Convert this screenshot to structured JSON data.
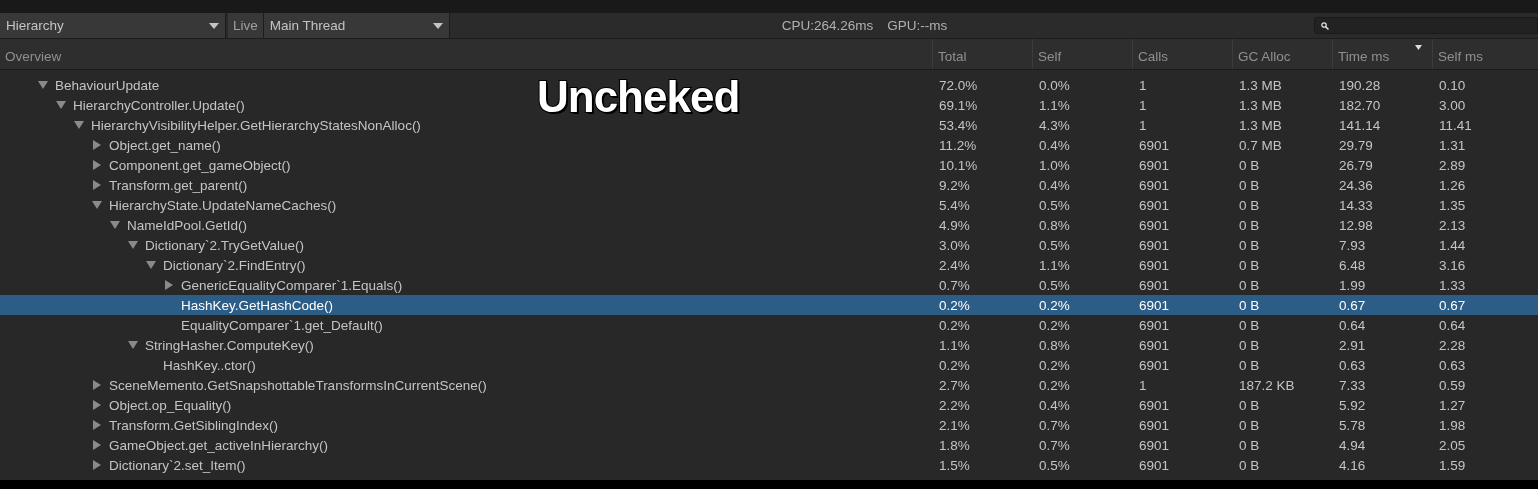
{
  "toolbar": {
    "view_dropdown": "Hierarchy",
    "live_button": "Live",
    "thread_dropdown": "Main Thread",
    "cpu": "CPU:264.26ms",
    "gpu": "GPU:--ms"
  },
  "table": {
    "columns": [
      {
        "label": "Overview",
        "sorted": false
      },
      {
        "label": "Total",
        "sorted": false
      },
      {
        "label": "Self",
        "sorted": false
      },
      {
        "label": "Calls",
        "sorted": false
      },
      {
        "label": "GC Alloc",
        "sorted": false
      },
      {
        "label": "Time ms",
        "sorted": true
      },
      {
        "label": "Self ms",
        "sorted": false
      }
    ],
    "rows": [
      {
        "kind": "group",
        "expanded": true,
        "selected": false,
        "cells": [
          "BehaviourUpdate",
          "72.0%",
          "0.0%",
          "1",
          "1.3 MB",
          "190.28",
          "0.10"
        ],
        "children": [
          {
            "kind": "group",
            "expanded": true,
            "selected": false,
            "cells": [
              "HierarchyController.Update()",
              "69.1%",
              "1.1%",
              "1",
              "1.3 MB",
              "182.70",
              "3.00"
            ],
            "children": [
              {
                "kind": "group",
                "expanded": true,
                "selected": false,
                "cells": [
                  "HierarchyVisibilityHelper.GetHierarchyStatesNonAlloc()",
                  "53.4%",
                  "4.3%",
                  "1",
                  "1.3 MB",
                  "141.14",
                  "11.41"
                ],
                "children": [
                  {
                    "kind": "group",
                    "expanded": false,
                    "selected": false,
                    "cells": [
                      "Object.get_name()",
                      "11.2%",
                      "0.4%",
                      "6901",
                      "0.7 MB",
                      "29.79",
                      "1.31"
                    ]
                  },
                  {
                    "kind": "group",
                    "expanded": false,
                    "selected": false,
                    "cells": [
                      "Component.get_gameObject()",
                      "10.1%",
                      "1.0%",
                      "6901",
                      "0 B",
                      "26.79",
                      "2.89"
                    ]
                  },
                  {
                    "kind": "group",
                    "expanded": false,
                    "selected": false,
                    "cells": [
                      "Transform.get_parent()",
                      "9.2%",
                      "0.4%",
                      "6901",
                      "0 B",
                      "24.36",
                      "1.26"
                    ]
                  },
                  {
                    "kind": "group",
                    "expanded": true,
                    "selected": false,
                    "cells": [
                      "HierarchyState.UpdateNameCaches()",
                      "5.4%",
                      "0.5%",
                      "6901",
                      "0 B",
                      "14.33",
                      "1.35"
                    ],
                    "children": [
                      {
                        "kind": "group",
                        "expanded": true,
                        "selected": false,
                        "cells": [
                          "NameIdPool.GetId()",
                          "4.9%",
                          "0.8%",
                          "6901",
                          "0 B",
                          "12.98",
                          "2.13"
                        ],
                        "children": [
                          {
                            "kind": "group",
                            "expanded": true,
                            "selected": false,
                            "cells": [
                              "Dictionary`2.TryGetValue()",
                              "3.0%",
                              "0.5%",
                              "6901",
                              "0 B",
                              "7.93",
                              "1.44"
                            ],
                            "children": [
                              {
                                "kind": "group",
                                "expanded": true,
                                "selected": false,
                                "cells": [
                                  "Dictionary`2.FindEntry()",
                                  "2.4%",
                                  "1.1%",
                                  "6901",
                                  "0 B",
                                  "6.48",
                                  "3.16"
                                ],
                                "children": [
                                  {
                                    "kind": "group",
                                    "expanded": false,
                                    "selected": false,
                                    "cells": [
                                      "GenericEqualityComparer`1.Equals()",
                                      "0.7%",
                                      "0.5%",
                                      "6901",
                                      "0 B",
                                      "1.99",
                                      "1.33"
                                    ]
                                  },
                                  {
                                    "kind": "leaf",
                                    "selected": true,
                                    "cells": [
                                      "HashKey.GetHashCode()",
                                      "0.2%",
                                      "0.2%",
                                      "6901",
                                      "0 B",
                                      "0.67",
                                      "0.67"
                                    ]
                                  },
                                  {
                                    "kind": "leaf",
                                    "selected": false,
                                    "cells": [
                                      "EqualityComparer`1.get_Default()",
                                      "0.2%",
                                      "0.2%",
                                      "6901",
                                      "0 B",
                                      "0.64",
                                      "0.64"
                                    ]
                                  }
                                ]
                              }
                            ]
                          },
                          {
                            "kind": "group",
                            "expanded": true,
                            "selected": false,
                            "cells": [
                              "StringHasher.ComputeKey()",
                              "1.1%",
                              "0.8%",
                              "6901",
                              "0 B",
                              "2.91",
                              "2.28"
                            ],
                            "children": [
                              {
                                "kind": "leaf",
                                "selected": false,
                                "cells": [
                                  "HashKey..ctor()",
                                  "0.2%",
                                  "0.2%",
                                  "6901",
                                  "0 B",
                                  "0.63",
                                  "0.63"
                                ]
                              }
                            ]
                          }
                        ]
                      }
                    ]
                  },
                  {
                    "kind": "group",
                    "expanded": false,
                    "selected": false,
                    "cells": [
                      "SceneMemento.GetSnapshottableTransformsInCurrentScene()",
                      "2.7%",
                      "0.2%",
                      "1",
                      "187.2 KB",
                      "7.33",
                      "0.59"
                    ]
                  },
                  {
                    "kind": "group",
                    "expanded": false,
                    "selected": false,
                    "cells": [
                      "Object.op_Equality()",
                      "2.2%",
                      "0.4%",
                      "6901",
                      "0 B",
                      "5.92",
                      "1.27"
                    ]
                  },
                  {
                    "kind": "group",
                    "expanded": false,
                    "selected": false,
                    "cells": [
                      "Transform.GetSiblingIndex()",
                      "2.1%",
                      "0.7%",
                      "6901",
                      "0 B",
                      "5.78",
                      "1.98"
                    ]
                  },
                  {
                    "kind": "group",
                    "expanded": false,
                    "selected": false,
                    "cells": [
                      "GameObject.get_activeInHierarchy()",
                      "1.8%",
                      "0.7%",
                      "6901",
                      "0 B",
                      "4.94",
                      "2.05"
                    ]
                  },
                  {
                    "kind": "group",
                    "expanded": false,
                    "selected": false,
                    "cells": [
                      "Dictionary`2.set_Item()",
                      "1.5%",
                      "0.5%",
                      "6901",
                      "0 B",
                      "4.16",
                      "1.59"
                    ]
                  }
                ]
              }
            ]
          }
        ]
      }
    ]
  },
  "overlay_caption": "Uncheked"
}
